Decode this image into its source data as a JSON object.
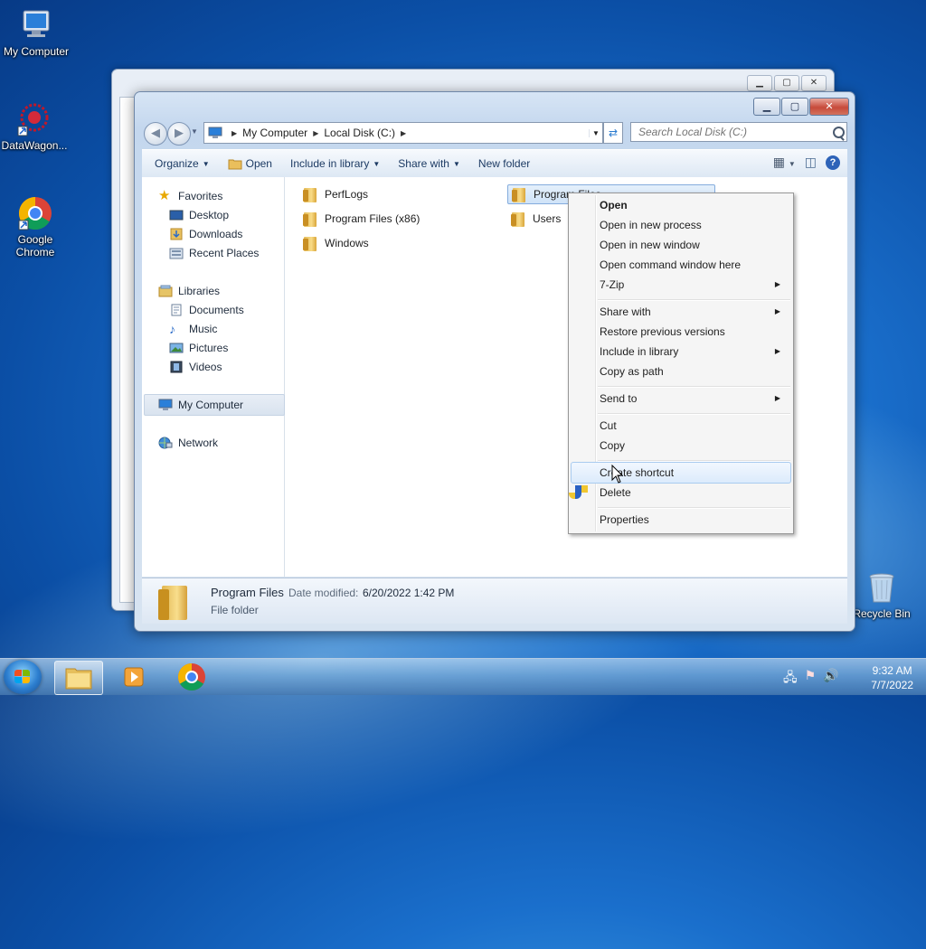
{
  "desktop": {
    "icons": [
      {
        "label": "My Computer"
      },
      {
        "label": "DataWagon..."
      },
      {
        "label": "Google Chrome"
      },
      {
        "label": "Recycle Bin"
      }
    ]
  },
  "window": {
    "address": {
      "crumbs": [
        "My Computer",
        "Local Disk (C:)"
      ]
    },
    "search": {
      "placeholder": "Search Local Disk (C:)"
    },
    "toolbar": {
      "organize": "Organize",
      "open": "Open",
      "include_in_library": "Include in library",
      "share_with": "Share with",
      "new_folder": "New folder"
    },
    "nav": {
      "favorites": "Favorites",
      "desktop": "Desktop",
      "downloads": "Downloads",
      "recent_places": "Recent Places",
      "libraries": "Libraries",
      "documents": "Documents",
      "music": "Music",
      "pictures": "Pictures",
      "videos": "Videos",
      "my_computer": "My Computer",
      "network": "Network"
    },
    "files": [
      {
        "name": "PerfLogs"
      },
      {
        "name": "Program Files (x86)"
      },
      {
        "name": "Windows"
      },
      {
        "name": "Program Files"
      },
      {
        "name": "Users"
      }
    ],
    "details": {
      "name": "Program Files",
      "type": "File folder",
      "date_label": "Date modified:",
      "date": "6/20/2022 1:42 PM"
    }
  },
  "context_menu": {
    "items": [
      {
        "label": "Open"
      },
      {
        "label": "Open in new process"
      },
      {
        "label": "Open in new window"
      },
      {
        "label": "Open command window here"
      },
      {
        "label": "7-Zip"
      },
      {
        "label": "Share with"
      },
      {
        "label": "Restore previous versions"
      },
      {
        "label": "Include in library"
      },
      {
        "label": "Copy as path"
      },
      {
        "label": "Send to"
      },
      {
        "label": "Cut"
      },
      {
        "label": "Copy"
      },
      {
        "label": "Create shortcut"
      },
      {
        "label": "Delete"
      },
      {
        "label": "Properties"
      }
    ]
  },
  "taskbar": {
    "time": "9:32 AM",
    "date": "7/7/2022"
  }
}
